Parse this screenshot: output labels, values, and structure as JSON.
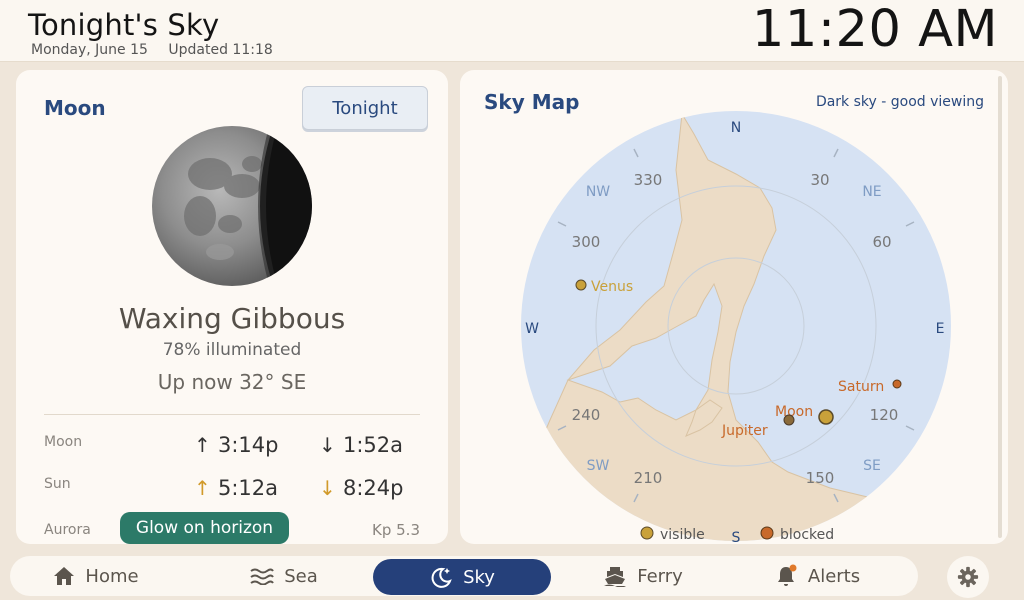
{
  "header": {
    "title": "Tonight's Sky",
    "date": "Monday, June 15",
    "updated": "Updated 11:18",
    "clock": "11:20 AM"
  },
  "moon": {
    "title": "Moon",
    "tonight_button": "Tonight",
    "phase": "Waxing Gibbous",
    "illumination": "78% illuminated",
    "position": "Up now 32° SE",
    "rows": {
      "moon_label": "Moon",
      "moon_rise": "3:14p",
      "moon_set": "1:52a",
      "sun_label": "Sun",
      "sun_rise": "5:12a",
      "sun_set": "8:24p",
      "aurora_label": "Aurora",
      "aurora_status": "Glow on horizon",
      "kp": "Kp 5.3"
    }
  },
  "skymap": {
    "title": "Sky Map",
    "status": "Dark sky - good viewing",
    "compass": {
      "n": "N",
      "e": "E",
      "s": "S",
      "w": "W",
      "ne": "NE",
      "nw": "NW",
      "se": "SE",
      "sw": "SW"
    },
    "degrees": {
      "d30": "30",
      "d60": "60",
      "d120": "120",
      "d150": "150",
      "d210": "210",
      "d240": "240",
      "d300": "300",
      "d330": "330"
    },
    "objects": {
      "venus": "Venus",
      "saturn": "Saturn",
      "moon": "Moon",
      "jupiter": "Jupiter"
    },
    "legend": {
      "visible": "visible",
      "blocked": "blocked"
    },
    "colors": {
      "sky": "#d6e2f3",
      "land": "#ecdcc6",
      "visible": "#c9a13a",
      "blocked": "#c8692a"
    }
  },
  "nav": {
    "home": "Home",
    "sea": "Sea",
    "sky": "Sky",
    "ferry": "Ferry",
    "alerts": "Alerts",
    "active": "Sky"
  }
}
